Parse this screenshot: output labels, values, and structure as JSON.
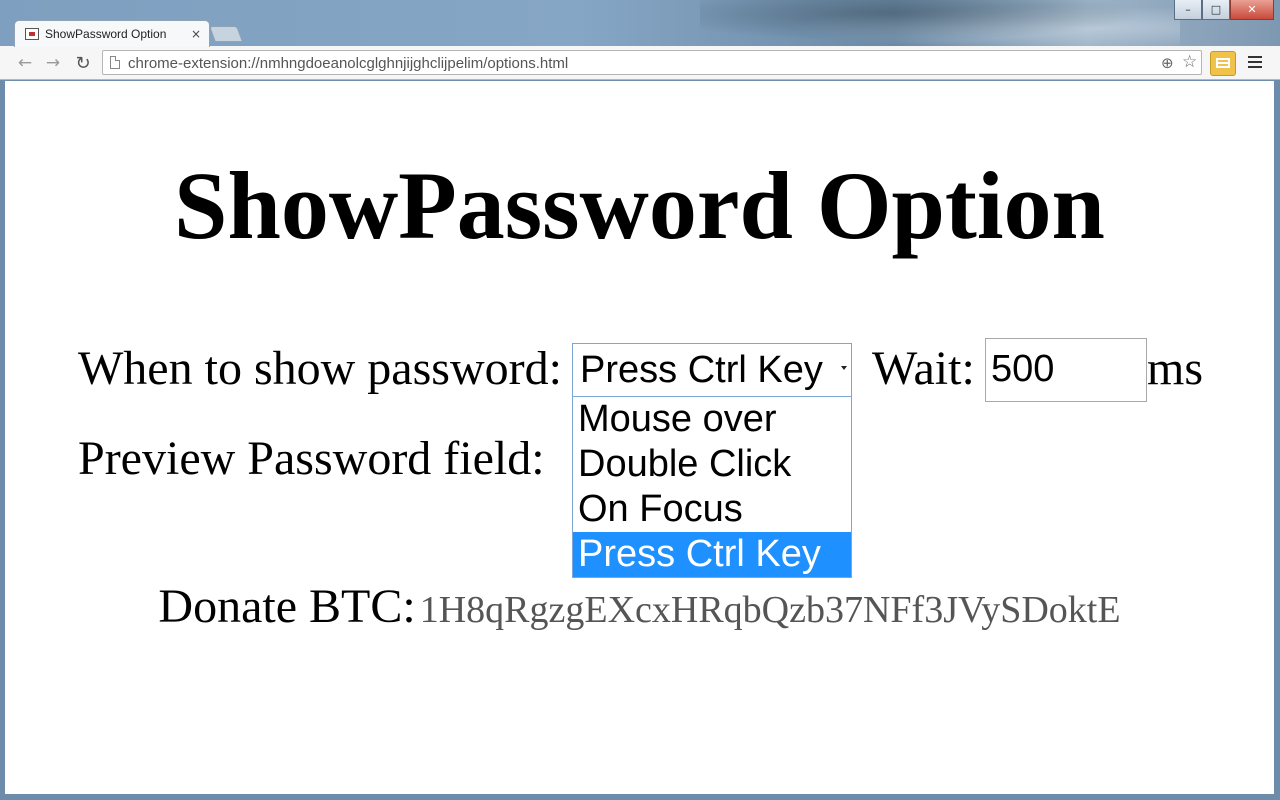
{
  "window": {
    "controls": {
      "minimize": "–",
      "maximize": "□",
      "close": "✕"
    }
  },
  "tab": {
    "title": "ShowPassword Option",
    "close": "×",
    "favicon": "extension-page-icon"
  },
  "toolbar": {
    "back": "←",
    "forward": "→",
    "reload": "↻",
    "url": "chrome-extension://nmhngdoeanolcglghnjijghclijpelim/options.html",
    "zoom_icon": "⊕",
    "star_icon": "☆"
  },
  "page": {
    "title": "ShowPassword Option",
    "when_label": "When to show password:",
    "select": {
      "value": "Press Ctrl Key",
      "options": [
        {
          "label": "Mouse over",
          "selected": false
        },
        {
          "label": "Double Click",
          "selected": false
        },
        {
          "label": "On Focus",
          "selected": false
        },
        {
          "label": "Press Ctrl Key",
          "selected": true
        }
      ]
    },
    "wait_label": "Wait:",
    "wait_value": "500",
    "wait_unit": "ms",
    "preview_label": "Preview Password field:",
    "donate_label": "Donate BTC:",
    "donate_address": "1H8qRgzgEXcxHRqbQzb37NFf3JVySDoktE"
  },
  "colors": {
    "selected_option": "#1e90ff",
    "select_border": "#7ca6d8",
    "donate_address": "#555555"
  }
}
